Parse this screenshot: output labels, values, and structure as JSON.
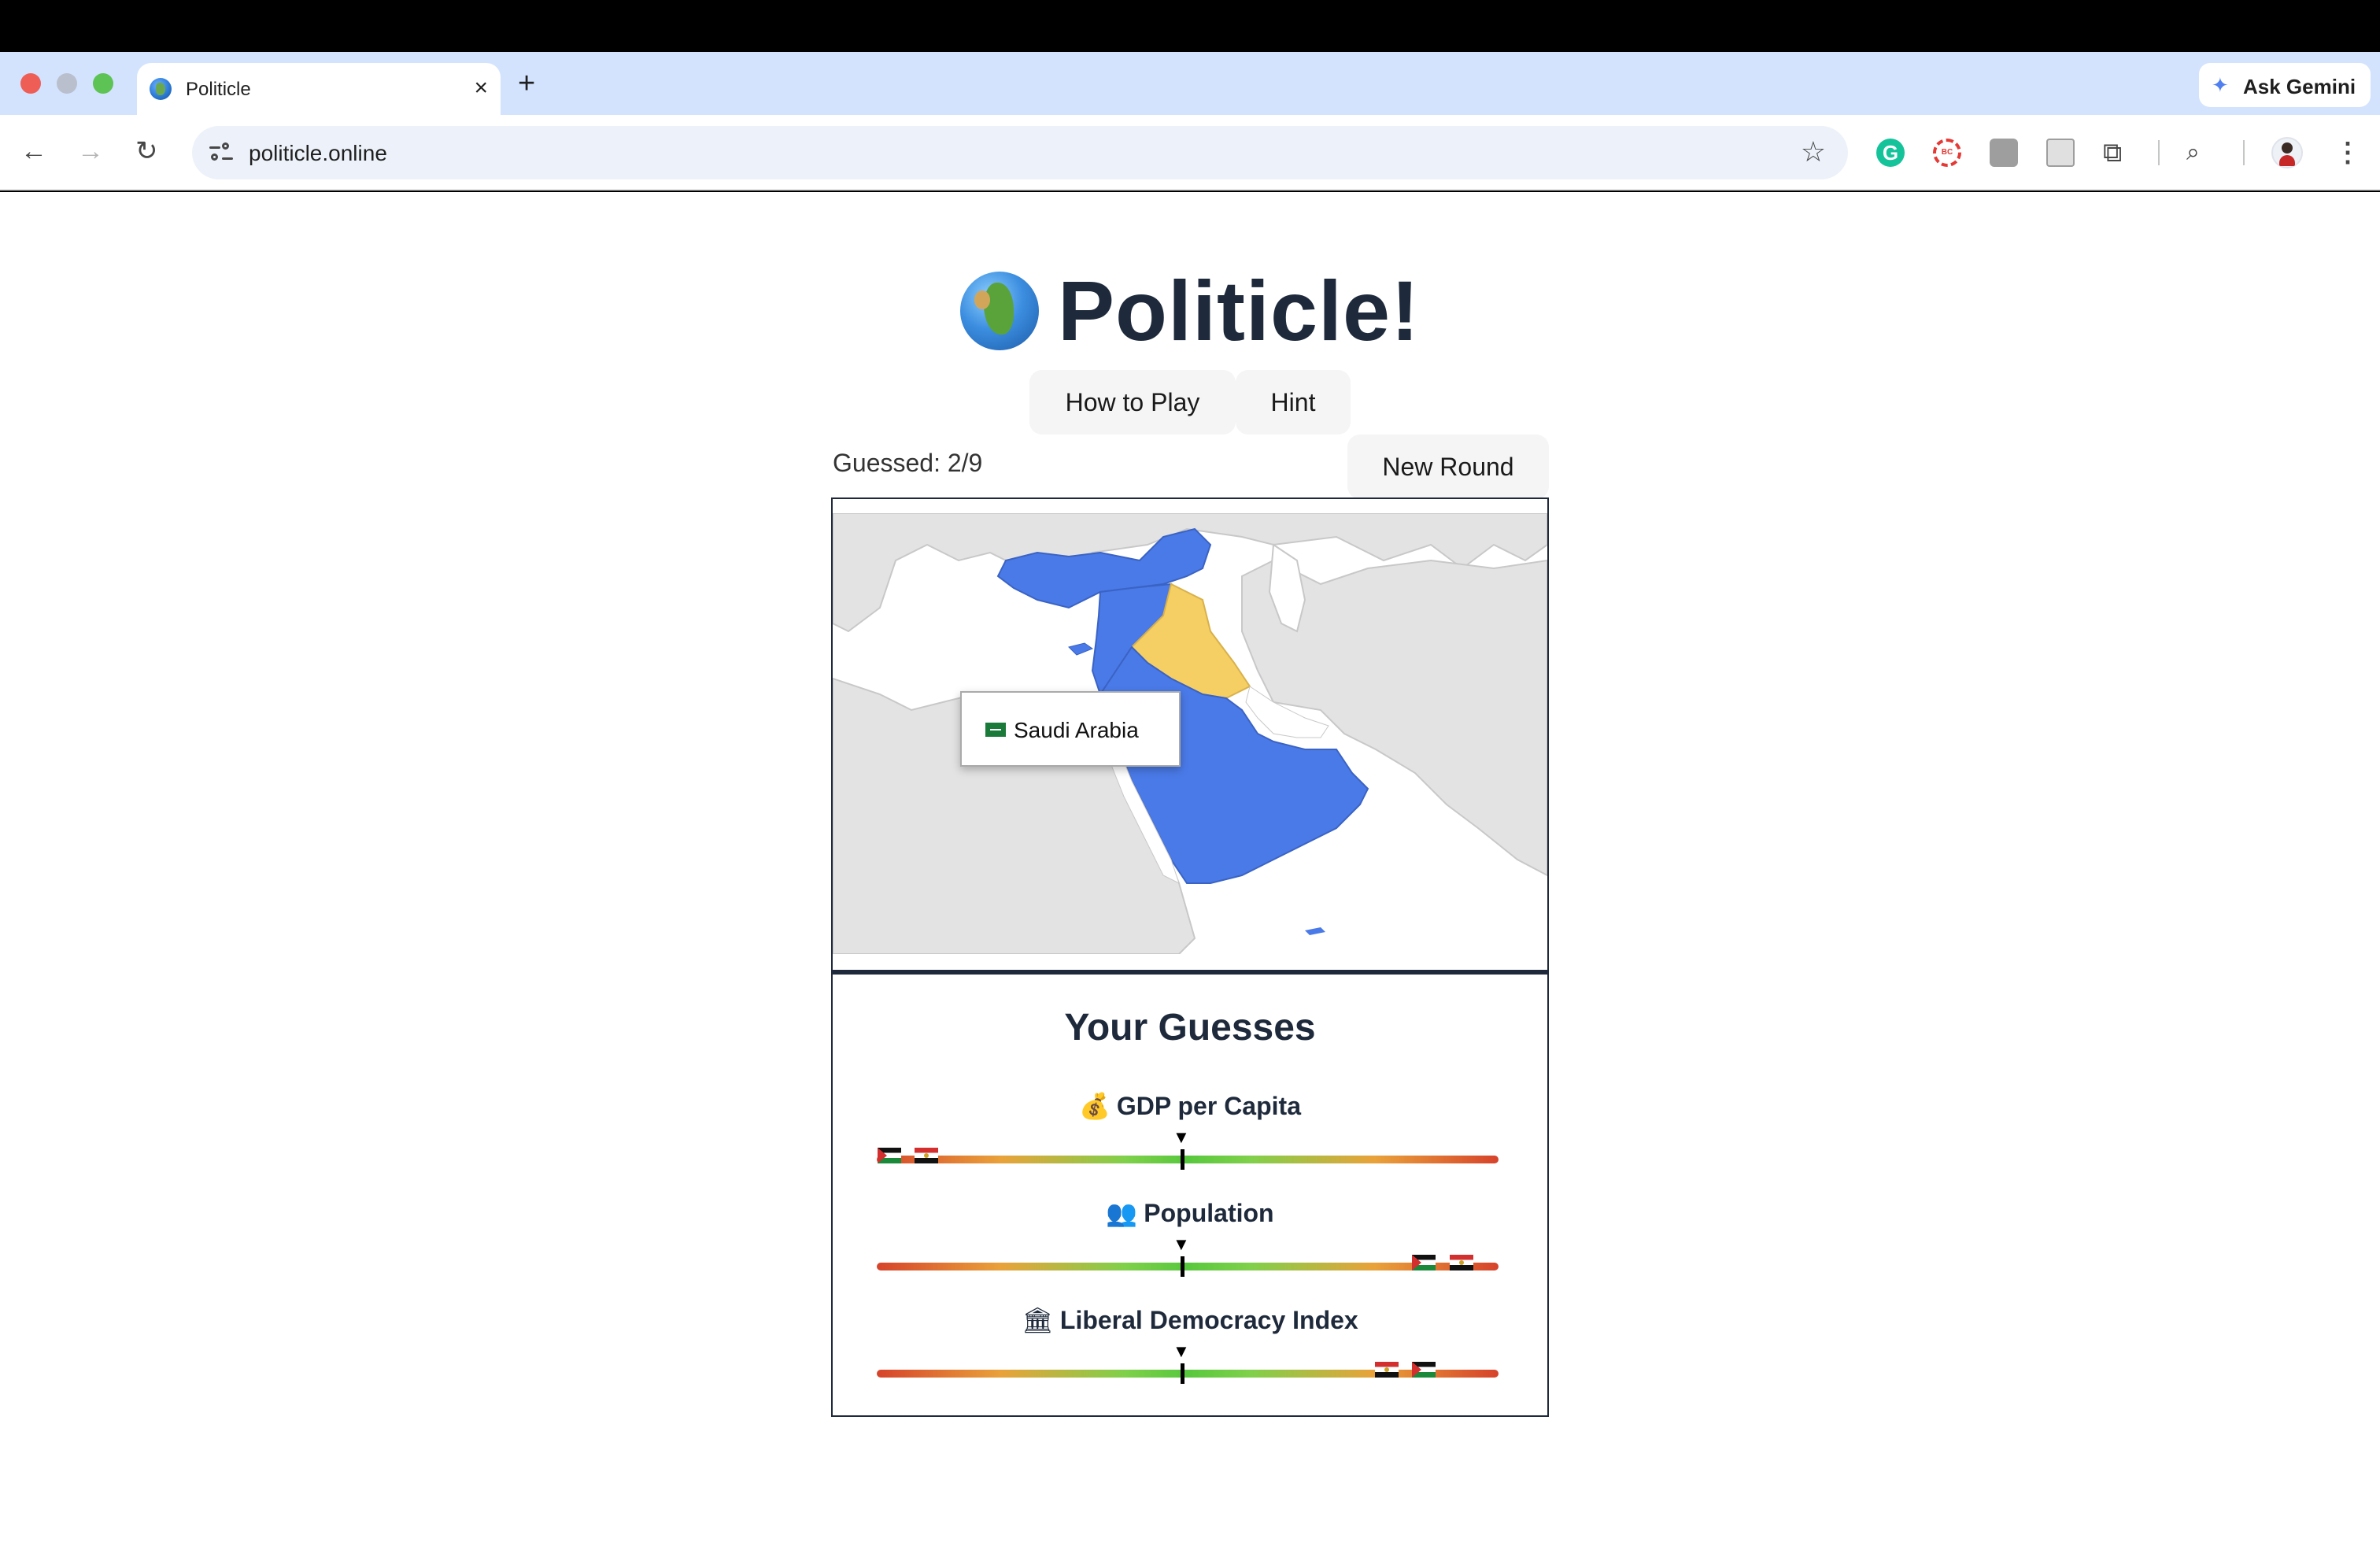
{
  "browser": {
    "tab_title": "Politicle",
    "tab_close": "×",
    "new_tab": "+",
    "ask_gemini": "Ask Gemini",
    "url": "politicle.online",
    "icons": [
      "back-icon",
      "forward-icon",
      "reload-icon",
      "site-info-icon",
      "bookmark-star-icon",
      "grammarly-extension-icon",
      "red-extension-icon",
      "grey-extension-icon",
      "file-extension-icon",
      "extensions-puzzle-icon",
      "tab-search-icon",
      "profile-avatar",
      "more-menu-icon"
    ]
  },
  "page": {
    "title": "Politicle!",
    "title_icon": "globe-icon",
    "how_to_play": "How to Play",
    "hint": "Hint",
    "guessed": "Guessed: 2/9",
    "new_round": "New Round"
  },
  "map": {
    "tooltip": "Saudi Arabia",
    "tooltip_flag": "saudi-arabia-flag",
    "colors": {
      "guessed": "#4a7ae8",
      "highlight": "#f5cf63",
      "land": "#e3e3e3",
      "sea": "#ffffff",
      "border": "#c8c8c8"
    }
  },
  "guesses": {
    "title": "Your Guesses",
    "metrics": [
      {
        "emoji": "💰",
        "label": "GDP per Capita",
        "flags": [
          {
            "country": "palestine",
            "position": 0.02
          },
          {
            "country": "egypt",
            "position": 0.08
          }
        ]
      },
      {
        "emoji": "👥",
        "label": "Population",
        "flags": [
          {
            "country": "palestine",
            "position": 0.88
          },
          {
            "country": "egypt",
            "position": 0.94
          }
        ]
      },
      {
        "emoji": "🏛",
        "label": "Liberal Democracy Index",
        "flags": [
          {
            "country": "egypt",
            "position": 0.82
          },
          {
            "country": "palestine",
            "position": 0.88
          }
        ]
      }
    ],
    "target_marker": "▼"
  }
}
